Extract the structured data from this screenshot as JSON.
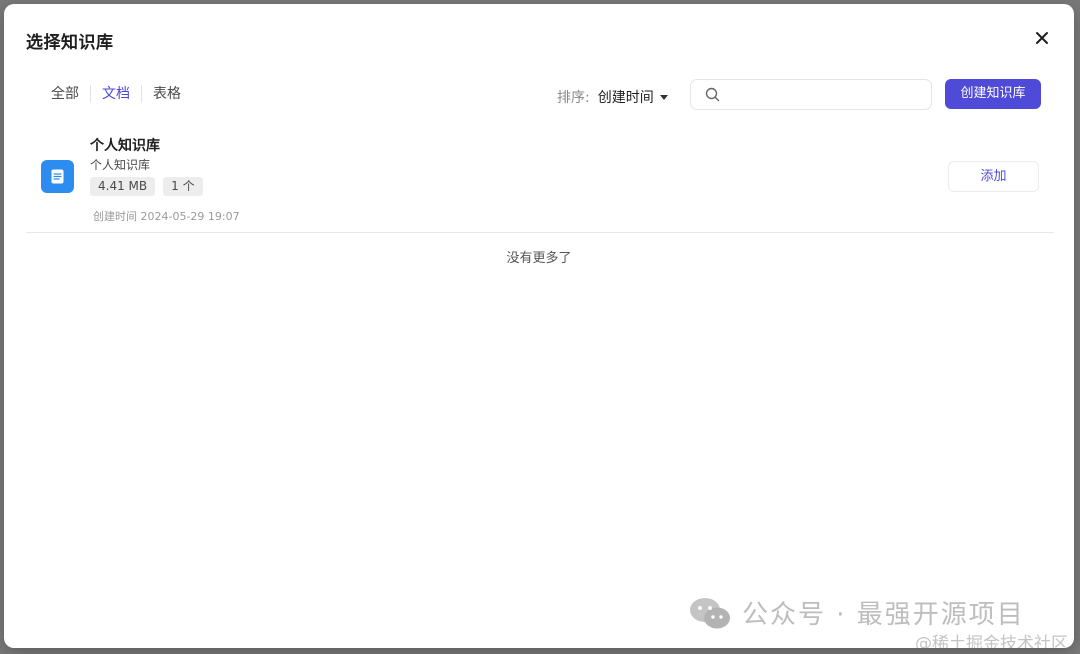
{
  "dialog": {
    "title": "选择知识库"
  },
  "tabs": [
    {
      "label": "全部",
      "active": false
    },
    {
      "label": "文档",
      "active": true
    },
    {
      "label": "表格",
      "active": false
    }
  ],
  "sort": {
    "label": "排序:",
    "value": "创建时间"
  },
  "search": {
    "placeholder": ""
  },
  "create_button_label": "创建知识库",
  "items": [
    {
      "title": "个人知识库",
      "description": "个人知识库",
      "tags": [
        "4.41 MB",
        "1 个"
      ],
      "created": "创建时间 2024-05-29 19:07",
      "action_label": "添加"
    }
  ],
  "list_end_text": "没有更多了",
  "watermark": {
    "text": "公众号 · 最强开源项目",
    "subtext": "@稀土掘金技术社区"
  },
  "colors": {
    "accent": "#4f4ad8",
    "doc_icon": "#2d8cf0"
  }
}
